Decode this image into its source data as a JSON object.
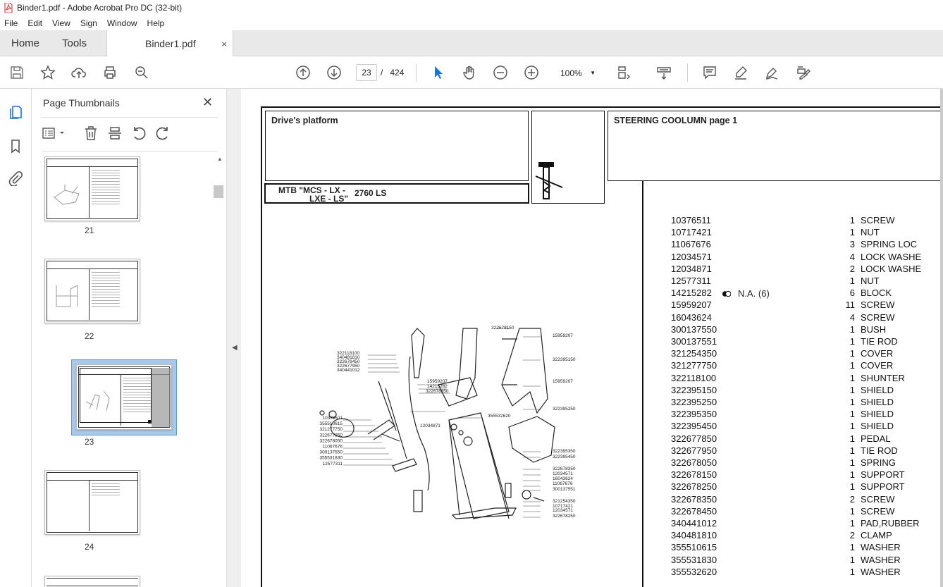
{
  "window": {
    "title": "Binder1.pdf - Adobe Acrobat Pro DC (32-bit)"
  },
  "menu": [
    "File",
    "Edit",
    "View",
    "Sign",
    "Window",
    "Help"
  ],
  "tabs": {
    "home": "Home",
    "tools": "Tools",
    "document": "Binder1.pdf",
    "close_glyph": "×"
  },
  "toolbar": {
    "current_page": "23",
    "page_separator": "/",
    "total_pages": "424",
    "zoom": "100%"
  },
  "thumbnails_panel": {
    "title": "Page Thumbnails",
    "close_glyph": "✕",
    "pages": [
      {
        "label": "21"
      },
      {
        "label": "22"
      },
      {
        "label": "23",
        "selected": true
      },
      {
        "label": "24"
      }
    ]
  },
  "document_page": {
    "section_title": "Drive's platform",
    "model_line1": "MTB \"MCS - LX -",
    "model_line2": "LXE - LS\"",
    "model_number": "2760  LS",
    "page_title": "STEERING COOLUMN  page 1",
    "na_note": "N.A.  (6)",
    "parts": [
      {
        "part_no": "10376511",
        "qty": "1",
        "desc": "SCREW"
      },
      {
        "part_no": "10717421",
        "qty": "1",
        "desc": "NUT"
      },
      {
        "part_no": "11067676",
        "qty": "3",
        "desc": "SPRING LOC"
      },
      {
        "part_no": "12034571",
        "qty": "4",
        "desc": "LOCK WASHE"
      },
      {
        "part_no": "12034871",
        "qty": "2",
        "desc": "LOCK WASHE"
      },
      {
        "part_no": "12577311",
        "qty": "1",
        "desc": "NUT"
      },
      {
        "part_no": "14215282",
        "qty": "6",
        "desc": "BLOCK"
      },
      {
        "part_no": "15959207",
        "qty": "11",
        "desc": "SCREW"
      },
      {
        "part_no": "16043624",
        "qty": "4",
        "desc": "SCREW"
      },
      {
        "part_no": "300137550",
        "qty": "1",
        "desc": "BUSH"
      },
      {
        "part_no": "300137551",
        "qty": "1",
        "desc": "TIE ROD"
      },
      {
        "part_no": "321254350",
        "qty": "1",
        "desc": "COVER"
      },
      {
        "part_no": "321277750",
        "qty": "1",
        "desc": "COVER"
      },
      {
        "part_no": "322118100",
        "qty": "1",
        "desc": "SHUNTER"
      },
      {
        "part_no": "322395150",
        "qty": "1",
        "desc": "SHIELD"
      },
      {
        "part_no": "322395250",
        "qty": "1",
        "desc": "SHIELD"
      },
      {
        "part_no": "322395350",
        "qty": "1",
        "desc": "SHIELD"
      },
      {
        "part_no": "322395450",
        "qty": "1",
        "desc": "SHIELD"
      },
      {
        "part_no": "322677850",
        "qty": "1",
        "desc": "PEDAL"
      },
      {
        "part_no": "322677950",
        "qty": "1",
        "desc": "TIE ROD"
      },
      {
        "part_no": "322678050",
        "qty": "1",
        "desc": "SPRING"
      },
      {
        "part_no": "322678150",
        "qty": "1",
        "desc": "SUPPORT"
      },
      {
        "part_no": "322678250",
        "qty": "1",
        "desc": "SUPPORT"
      },
      {
        "part_no": "322678350",
        "qty": "2",
        "desc": "SCREW"
      },
      {
        "part_no": "322678450",
        "qty": "1",
        "desc": "SCREW"
      },
      {
        "part_no": "340441012",
        "qty": "1",
        "desc": "PAD,RUBBER"
      },
      {
        "part_no": "340481810",
        "qty": "2",
        "desc": "CLAMP"
      },
      {
        "part_no": "355510615",
        "qty": "1",
        "desc": "WASHER"
      },
      {
        "part_no": "355531830",
        "qty": "1",
        "desc": "WASHER"
      },
      {
        "part_no": "355532620",
        "qty": "1",
        "desc": "WASHER"
      }
    ],
    "diagram_labels": {
      "top_left": [
        "322118100",
        "340481810",
        "322678450",
        "322677950",
        "340441012"
      ],
      "left": [
        "10376511",
        "355510615",
        "321277750",
        "322677850",
        "322678050",
        "11067676",
        "300137550",
        "355531830",
        "12577311"
      ],
      "center": [
        "15959207",
        "14215282",
        "322678350",
        "322678150",
        "355532620",
        "12034871"
      ],
      "right": [
        "15959207",
        "322395150",
        "15959207",
        "322395250",
        "322395350",
        "322395450",
        "322678350",
        "12034571",
        "16043624",
        "11067676",
        "300137551",
        "321254350",
        "10717421",
        "12034571",
        "322678250"
      ]
    }
  }
}
